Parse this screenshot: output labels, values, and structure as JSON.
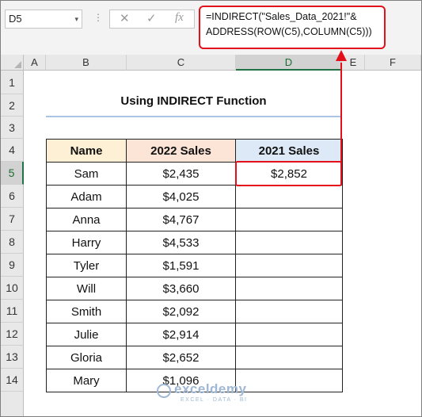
{
  "name_box": {
    "value": "D5",
    "dropdown_glyph": "▾"
  },
  "formula_bar": {
    "dots": "⋮",
    "cancel": "✕",
    "enter": "✓",
    "fx": "fx",
    "formula_line1": "=INDIRECT(\"Sales_Data_2021!\"&",
    "formula_line2": "ADDRESS(ROW(C5),COLUMN(C5)))"
  },
  "columns": [
    "A",
    "B",
    "C",
    "D",
    "E",
    "F"
  ],
  "selected_column": "D",
  "rows": [
    "1",
    "2",
    "3",
    "4",
    "5",
    "6",
    "7",
    "8",
    "9",
    "10",
    "11",
    "12",
    "13",
    "14"
  ],
  "selected_row": "5",
  "sheet_title": "Using INDIRECT Function",
  "table": {
    "headers": [
      "Name",
      "2022 Sales",
      "2021 Sales"
    ],
    "rows": [
      {
        "name": "Sam",
        "s2022": "$2,435",
        "s2021": "$2,852"
      },
      {
        "name": "Adam",
        "s2022": "$4,025",
        "s2021": ""
      },
      {
        "name": "Anna",
        "s2022": "$4,767",
        "s2021": ""
      },
      {
        "name": "Harry",
        "s2022": "$4,533",
        "s2021": ""
      },
      {
        "name": "Tyler",
        "s2022": "$1,591",
        "s2021": ""
      },
      {
        "name": "Will",
        "s2022": "$3,660",
        "s2021": ""
      },
      {
        "name": "Smith",
        "s2022": "$2,092",
        "s2021": ""
      },
      {
        "name": "Julie",
        "s2022": "$2,914",
        "s2021": ""
      },
      {
        "name": "Gloria",
        "s2022": "$2,652",
        "s2021": ""
      },
      {
        "name": "Mary",
        "s2022": "$1,096",
        "s2021": ""
      }
    ]
  },
  "watermark": {
    "name": "exceldemy",
    "tagline": "EXCEL · DATA · BI"
  },
  "colors": {
    "highlight": "#e3101a",
    "header_name": "#fdf0d5",
    "header_2022": "#fce4d6",
    "header_2021": "#dde9f6",
    "selection": "#217346"
  }
}
